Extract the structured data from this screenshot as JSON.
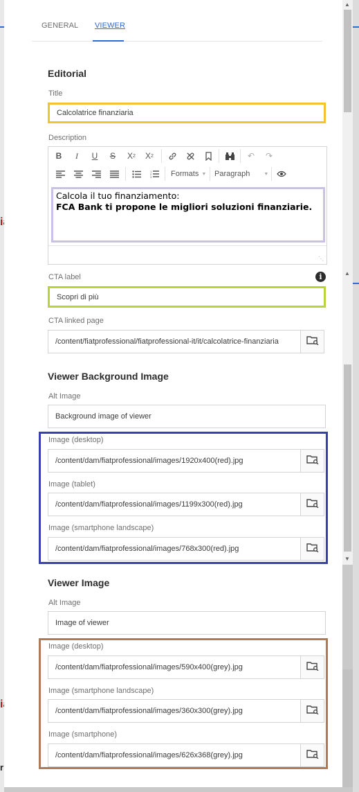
{
  "tabs": [
    {
      "label": "GENERAL"
    },
    {
      "label": "VIEWER"
    }
  ],
  "editorial": {
    "heading": "Editorial",
    "title_label": "Title",
    "title_value": "Calcolatrice finanziaria",
    "description_label": "Description",
    "description_lines": [
      "Calcola il tuo finanziamento:",
      "FCA Bank ti propone le migliori soluzioni finanziarie."
    ],
    "toolbar": {
      "formats": "Formats",
      "paragraph": "Paragraph"
    },
    "cta_label": "CTA label",
    "cta_value": "Scopri di più",
    "cta_linked_label": "CTA linked page",
    "cta_linked_value": "/content/fiatprofessional/fiatprofessional-it/it/calcolatrice-finanziaria"
  },
  "viewer_bg": {
    "heading": "Viewer Background Image",
    "alt_label": "Alt Image",
    "alt_value": "Background image of viewer",
    "desktop_label": "Image (desktop)",
    "desktop_value": "/content/dam/fiatprofessional/images/1920x400(red).jpg",
    "tablet_label": "Image (tablet)",
    "tablet_value": "/content/dam/fiatprofessional/images/1199x300(red).jpg",
    "landscape_label": "Image (smartphone landscape)",
    "landscape_value": "/content/dam/fiatprofessional/images/768x300(red).jpg"
  },
  "viewer_image": {
    "heading": "Viewer Image",
    "alt_label": "Alt Image",
    "alt_value": "Image of viewer",
    "desktop_label": "Image (desktop)",
    "desktop_value": "/content/dam/fiatprofessional/images/590x400(grey).jpg",
    "landscape_label": "Image (smartphone landscape)",
    "landscape_value": "/content/dam/fiatprofessional/images/360x300(grey).jpg",
    "smartphone_label": "Image (smartphone)",
    "smartphone_value": "/content/dam/fiatprofessional/images/626x368(grey).jpg"
  },
  "background": {
    "fragment_letters": [
      "ia",
      "ia",
      "r"
    ]
  },
  "colors": {
    "title_highlight": "#f2c230",
    "cta_highlight": "#b8d43a",
    "bg_group_highlight": "#3a3fb0",
    "viewer_group_highlight": "#b07a55",
    "description_highlight": "#c9c2e6",
    "accent": "#2d6bd6"
  }
}
